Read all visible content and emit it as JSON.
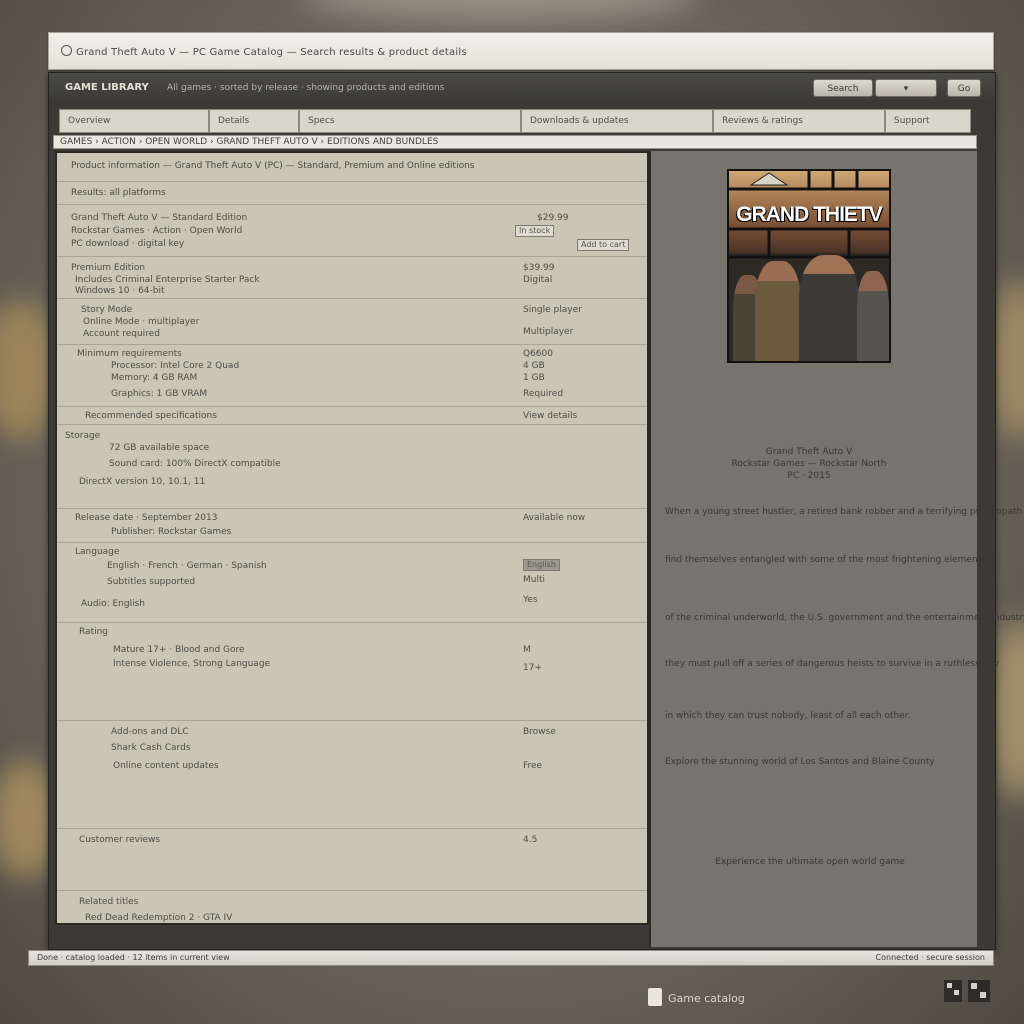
{
  "browser": {
    "url": "Grand Theft Auto V — PC Game Catalog — Search results & product details"
  },
  "window": {
    "app_title": "GAME LIBRARY",
    "subtitle": "All games · sorted by release · showing products and editions",
    "buttons": [
      "Search",
      "Go"
    ]
  },
  "tabs": [
    "Overview",
    "Details",
    "Specs",
    "Downloads & updates",
    "Reviews & ratings",
    "Support"
  ],
  "breadcrumb": "GAMES › ACTION › OPEN WORLD › GRAND THEFT AUTO V › EDITIONS AND BUNDLES",
  "list": {
    "header": "Product information — Grand Theft Auto V (PC) — Standard, Premium and Online editions",
    "subheader": "Results: all platforms",
    "rows": [
      {
        "lines": [
          "Grand Theft Auto V — Standard Edition",
          "Rockstar Games · Action · Open World",
          "PC download · digital key"
        ],
        "values": [
          "$29.99",
          "In stock",
          "Add to cart"
        ]
      },
      {
        "lines": [
          "Premium Edition",
          "Includes Criminal Enterprise Starter Pack",
          "Windows 10 · 64-bit"
        ],
        "values": [
          "$39.99",
          "Digital",
          ""
        ]
      },
      {
        "lines": [
          "Story Mode",
          "Online Mode · multiplayer",
          "Account required"
        ],
        "values": [
          "Single player",
          "Multiplayer",
          ""
        ]
      },
      {
        "lines": [
          "Minimum requirements",
          "Processor: Intel Core 2 Quad",
          "Memory: 4 GB RAM",
          "Graphics: 1 GB VRAM"
        ],
        "values": [
          "Q6600",
          "4 GB",
          "1 GB",
          "Required"
        ]
      },
      {
        "lines": [
          "Recommended specifications"
        ],
        "values": [
          "View details"
        ]
      },
      {
        "lines": [
          "Storage",
          "72 GB available space",
          "Sound card: 100% DirectX compatible",
          "DirectX version 10, 10.1, 11"
        ],
        "values": [
          "",
          "",
          ""
        ]
      },
      {
        "lines": [
          "Release date · September 2013",
          "Publisher: Rockstar Games"
        ],
        "values": [
          "Available now"
        ]
      },
      {
        "lines": [
          "Language",
          "English · French · German · Spanish",
          "Subtitles supported",
          "Audio: English"
        ],
        "values": [
          "English",
          "Multi",
          "Yes"
        ]
      },
      {
        "lines": [
          "Rating",
          "Mature 17+ · Blood and Gore",
          "Intense Violence, Strong Language"
        ],
        "values": [
          "M",
          "17+",
          ""
        ]
      },
      {
        "lines": [
          "Add-ons and DLC",
          "Shark Cash Cards",
          "Online content updates"
        ],
        "values": [
          "Browse",
          "Free"
        ]
      },
      {
        "lines": [
          "Customer reviews"
        ],
        "values": [
          "4.5"
        ]
      },
      {
        "lines": [
          "Related titles",
          "Red Dead Redemption 2 · GTA IV"
        ],
        "values": [
          ""
        ]
      }
    ]
  },
  "preview": {
    "cover_title": "GRAND THIETV",
    "caption": [
      "Grand Theft Auto V",
      "Rockstar Games — Rockstar North",
      "PC · 2015"
    ],
    "paragraphs": [
      "When a young street hustler, a retired bank robber and a terrifying psychopath",
      "find themselves entangled with some of the most frightening elements",
      "of the criminal underworld, the U.S. government and the entertainment industry",
      "they must pull off a series of dangerous heists to survive in a ruthless city",
      "in which they can trust nobody, least of all each other.",
      "Explore the stunning world of Los Santos and Blaine County",
      "Experience the ultimate open world game"
    ]
  },
  "status": {
    "left": "Done · catalog loaded · 12 items in current view",
    "right": "Connected · secure session"
  },
  "footer": {
    "brand": "Game catalog"
  }
}
